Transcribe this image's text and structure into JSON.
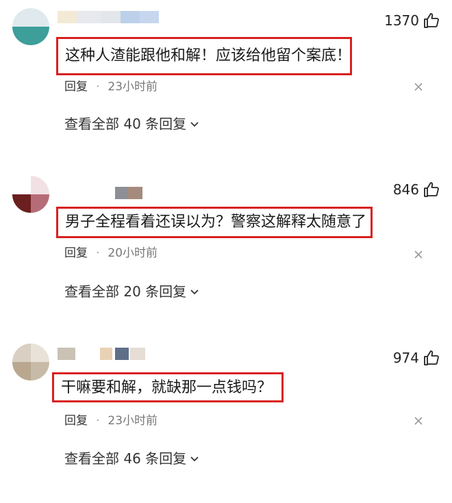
{
  "comments": [
    {
      "likes": "1370",
      "text": "这种人渣能跟他和解！应该给他留个案底！",
      "reply_label": "回复",
      "time": "23小时前",
      "view_all": "查看全部 40 条回复"
    },
    {
      "likes": "846",
      "text": "男子全程看着还误以为？警察这解释太随意了",
      "reply_label": "回复",
      "time": "20小时前",
      "view_all": "查看全部 20 条回复"
    },
    {
      "likes": "974",
      "text": "干嘛要和解，就缺那一点钱吗？",
      "reply_label": "回复",
      "time": "23小时前",
      "view_all": "查看全部 46 条回复"
    }
  ],
  "icons": {
    "like": "thumbs-up-icon",
    "close": "close-icon",
    "expand": "chevron-down-icon"
  },
  "colors": {
    "highlight_border": "#d8201f"
  }
}
